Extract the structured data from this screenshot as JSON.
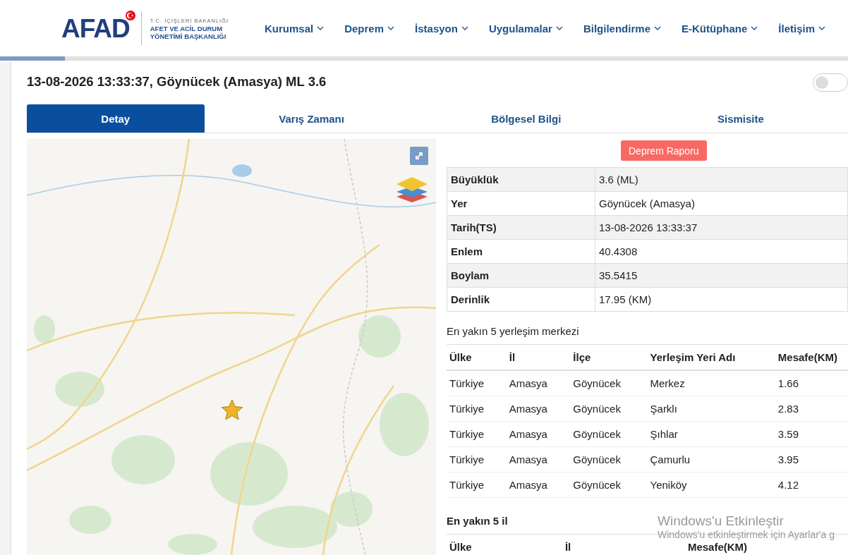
{
  "header": {
    "logo": {
      "mark": "AFAD",
      "ministry": "T.C. İÇİŞLERİ BAKANLIĞI",
      "agency_line1": "AFET VE ACİL DURUM",
      "agency_line2": "YÖNETİMİ BAŞKANLIĞI"
    },
    "nav": [
      {
        "label": "Kurumsal"
      },
      {
        "label": "Deprem"
      },
      {
        "label": "İstasyon"
      },
      {
        "label": "Uygulamalar"
      },
      {
        "label": "Bilgilendirme"
      },
      {
        "label": "E-Kütüphane"
      },
      {
        "label": "İletişim"
      }
    ]
  },
  "event_title": "13-08-2026 13:33:37, Göynücek (Amasya) ML 3.6",
  "toggle": {
    "on": false
  },
  "tabs": [
    {
      "label": "Detay",
      "selected": true
    },
    {
      "label": "Varış Zamanı",
      "selected": false
    },
    {
      "label": "Bölgesel Bilgi",
      "selected": false
    },
    {
      "label": "Sismisite",
      "selected": false
    }
  ],
  "report_button": "Deprem Raporu",
  "details": [
    {
      "label": "Büyüklük",
      "value": "3.6 (ML)"
    },
    {
      "label": "Yer",
      "value": "Göynücek (Amasya)"
    },
    {
      "label": "Tarih(TS)",
      "value": "13-08-2026 13:33:37"
    },
    {
      "label": "Enlem",
      "value": "40.4308"
    },
    {
      "label": "Boylam",
      "value": "35.5415"
    },
    {
      "label": "Derinlik",
      "value": "17.95 (KM)"
    }
  ],
  "nearest_settlements": {
    "title": "En yakın 5 yerleşim merkezi",
    "columns": [
      "Ülke",
      "İl",
      "İlçe",
      "Yerleşim Yeri Adı",
      "Mesafe(KM)"
    ],
    "rows": [
      [
        "Türkiye",
        "Amasya",
        "Göynücek",
        "Merkez",
        "1.66"
      ],
      [
        "Türkiye",
        "Amasya",
        "Göynücek",
        "Şarklı",
        "2.83"
      ],
      [
        "Türkiye",
        "Amasya",
        "Göynücek",
        "Şıhlar",
        "3.59"
      ],
      [
        "Türkiye",
        "Amasya",
        "Göynücek",
        "Çamurlu",
        "3.95"
      ],
      [
        "Türkiye",
        "Amasya",
        "Göynücek",
        "Yeniköy",
        "4.12"
      ]
    ]
  },
  "nearest_provinces": {
    "title": "En yakın 5 il",
    "columns": [
      "Ülke",
      "İl",
      "Mesafe(KM)"
    ]
  },
  "os_notice": {
    "title": "Windows'u Etkinleştir",
    "subtitle": "Windows'u etkinleştirmek için Ayarlar'a g"
  }
}
